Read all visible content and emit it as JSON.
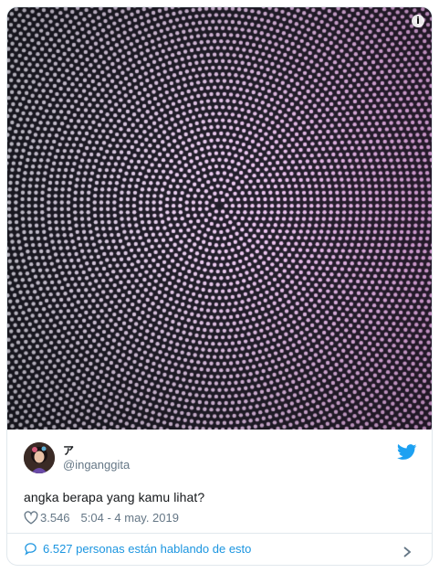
{
  "tweet": {
    "display_name": "ア",
    "handle": "@inganggita",
    "text": "angka berapa yang kamu lihat?",
    "like_count": "3.546",
    "timestamp": "5:04 - 4 may. 2019",
    "conversation_text": "6.527 personas están hablando de esto"
  },
  "icons": {
    "info": "info-icon",
    "brand": "twitter-bird-icon",
    "like": "heart-icon",
    "conversation": "speech-bubble-icon",
    "more": "chevron-right-icon"
  },
  "colors": {
    "link": "#1b95e0",
    "muted": "#657786",
    "text": "#14171a",
    "border": "#e1e8ed",
    "brand": "#1da1f2"
  }
}
